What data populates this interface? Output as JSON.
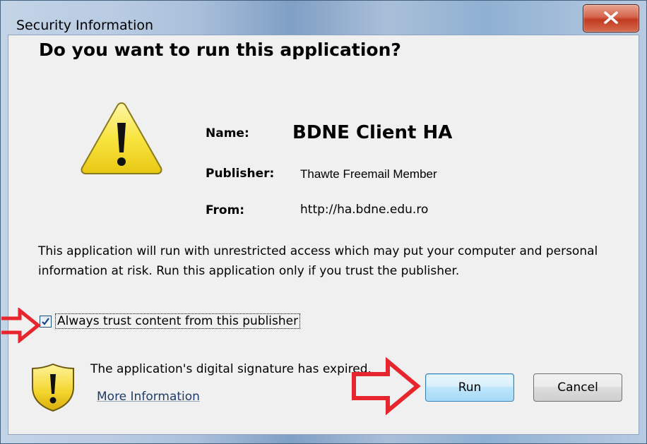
{
  "window": {
    "title": "Security Information"
  },
  "dialog": {
    "heading": "Do you want to run this application?",
    "fields": {
      "name_label": "Name:",
      "name_value": "BDNE Client HA",
      "publisher_label": "Publisher:",
      "publisher_value": "Thawte Freemail Member",
      "from_label": "From:",
      "from_value": "http://ha.bdne.edu.ro"
    },
    "message": "This application will run with unrestricted access which may put your computer and personal information at risk. Run this application only if you trust the publisher.",
    "trust_checkbox": {
      "label": "Always trust content from this publisher",
      "checked": true
    },
    "signature_warning": "The application's digital signature has expired.",
    "more_info_link": "More Information",
    "buttons": {
      "run": "Run",
      "cancel": "Cancel"
    }
  },
  "icons": {
    "main": "warning-triangle-icon",
    "signature": "warning-shield-icon",
    "close": "close-icon",
    "annotation": "red-arrow-icon"
  },
  "colors": {
    "warning_yellow": "#f7e33a",
    "annotation_red": "#e8252d",
    "close_red": "#c6432a",
    "link_blue": "#1f3c6e"
  }
}
